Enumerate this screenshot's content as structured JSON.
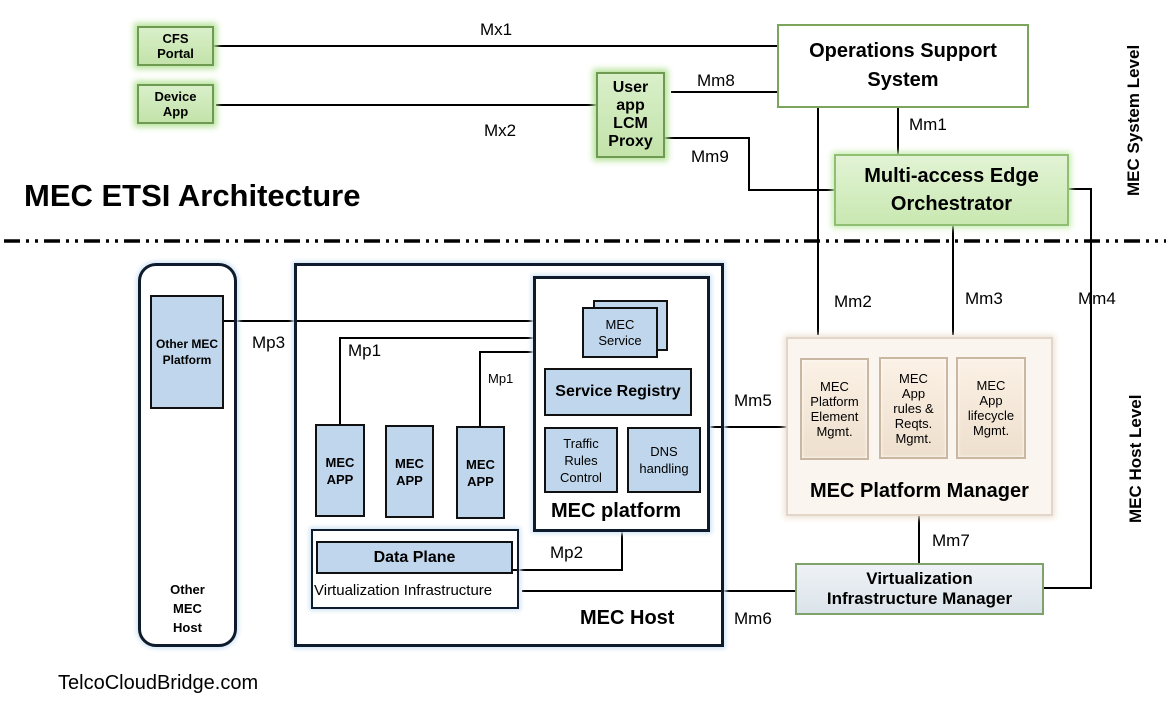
{
  "title": "MEC ETSI Architecture",
  "footer": "TelcoCloudBridge.com",
  "levels": {
    "system": "MEC System Level",
    "host": "MEC Host  Level"
  },
  "system": {
    "cfs_portal": [
      "CFS",
      "Portal"
    ],
    "device_app": [
      "Device",
      "App"
    ],
    "user_app_lcm_proxy": [
      "User",
      "app",
      "LCM",
      "Proxy"
    ],
    "oss": [
      "Operations Support",
      "System"
    ],
    "meo": [
      "Multi-access Edge",
      "Orchestrator"
    ]
  },
  "host": {
    "other_mec_host": {
      "label": [
        "Other",
        "MEC",
        "Host"
      ],
      "platform": [
        "Other MEC",
        "Platform"
      ]
    },
    "mec_host": {
      "label": "MEC Host",
      "apps": [
        [
          "MEC",
          "APP"
        ],
        [
          "MEC",
          "APP"
        ],
        [
          "MEC",
          "APP"
        ]
      ],
      "data_plane": "Data Plane",
      "virtualization_infrastructure": "Virtualization Infrastructure",
      "mec_platform": {
        "label": "MEC platform",
        "service": [
          "MEC",
          "Service"
        ],
        "service_registry": "Service Registry",
        "traffic_rules": [
          "Traffic",
          "Rules",
          "Control"
        ],
        "dns": [
          "DNS",
          "handling"
        ]
      }
    },
    "platform_manager": {
      "label": "MEC Platform Manager",
      "cells": [
        [
          "MEC",
          "Platform",
          "Element",
          "Mgmt."
        ],
        [
          "MEC",
          "App",
          "rules &",
          "Reqts.",
          "Mgmt."
        ],
        [
          "MEC",
          "App",
          "lifecycle",
          "Mgmt."
        ]
      ]
    },
    "vim": [
      "Virtualization",
      "Infrastructure Manager"
    ]
  },
  "reference_points": {
    "mx1": "Mx1",
    "mx2": "Mx2",
    "mm1": "Mm1",
    "mm2": "Mm2",
    "mm3": "Mm3",
    "mm4": "Mm4",
    "mm5": "Mm5",
    "mm6": "Mm6",
    "mm7": "Mm7",
    "mm8": "Mm8",
    "mm9": "Mm9",
    "mp1": "Mp1",
    "mp1_small": "Mp1",
    "mp2": "Mp2",
    "mp3": "Mp3"
  }
}
